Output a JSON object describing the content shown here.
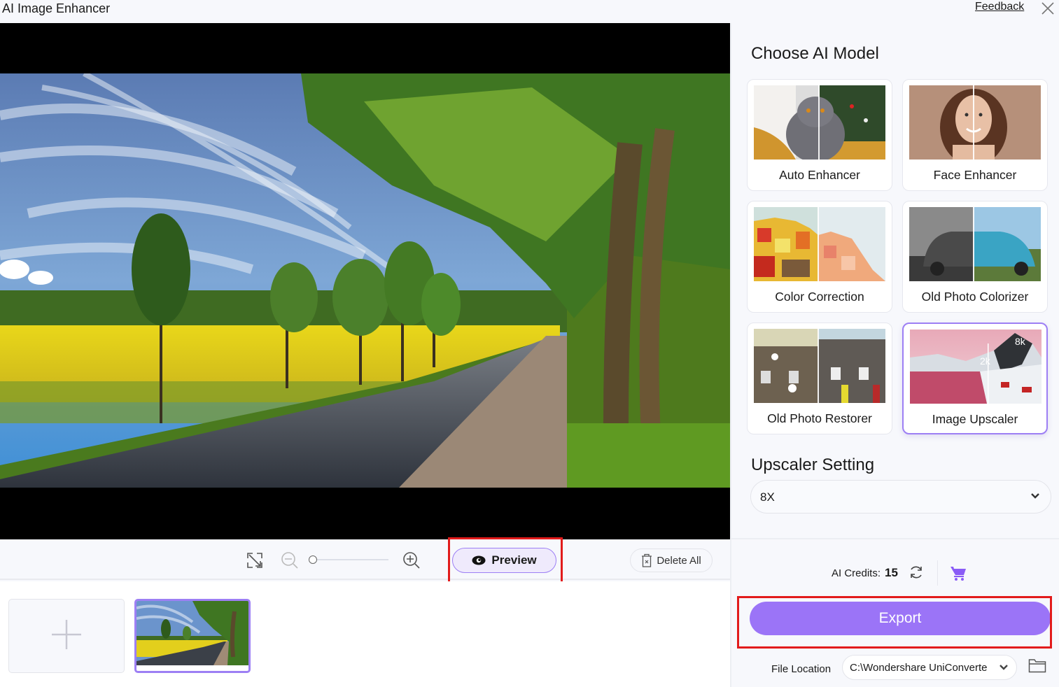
{
  "window": {
    "title": "AI Image Enhancer",
    "feedback_label": "Feedback",
    "close_icon": "close-icon"
  },
  "toolbar": {
    "fit_icon": "fit-to-screen-icon",
    "zoom_out_icon": "zoom-out-icon",
    "zoom_in_icon": "zoom-in-icon",
    "zoom_level": 0,
    "preview_label": "Preview",
    "preview_icon": "eye-icon",
    "delete_all_label": "Delete All",
    "delete_icon": "trash-icon"
  },
  "thumbnails": {
    "add_icon": "plus-icon",
    "items": [
      {
        "name": "country-road-landscape",
        "selected": true
      }
    ]
  },
  "right_panel": {
    "choose_model_title": "Choose AI Model",
    "models": [
      {
        "label": "Auto Enhancer",
        "selected": false
      },
      {
        "label": "Face Enhancer",
        "selected": false
      },
      {
        "label": "Color Correction",
        "selected": false
      },
      {
        "label": "Old Photo Colorizer",
        "selected": false
      },
      {
        "label": "Old Photo Restorer",
        "selected": false
      },
      {
        "label": "Image Upscaler",
        "selected": true
      }
    ],
    "upscaler_title": "Upscaler Setting",
    "upscaler_value": "8X",
    "upscaler_overlay": {
      "from": "2k",
      "to": "8k"
    },
    "credits_label": "AI Credits:",
    "credits_value": "15",
    "export_label": "Export",
    "file_location_label": "File Location",
    "file_location_value": "C:\\Wondershare UniConverte"
  },
  "colors": {
    "accent": "#9b74f7",
    "accent_border": "#9d7ff4",
    "highlight_red": "#e21b1b",
    "cart": "#8a5cf6"
  }
}
